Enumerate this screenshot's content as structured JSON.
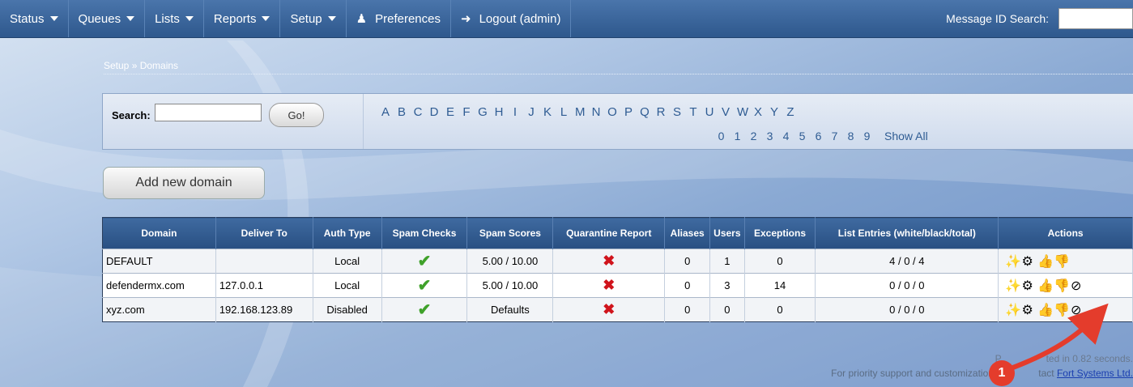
{
  "nav": {
    "items": [
      {
        "label": "Status",
        "dropdown": true
      },
      {
        "label": "Queues",
        "dropdown": true
      },
      {
        "label": "Lists",
        "dropdown": true
      },
      {
        "label": "Reports",
        "dropdown": true
      },
      {
        "label": "Setup",
        "dropdown": true
      }
    ],
    "preferences_label": "Preferences",
    "logout_label": "Logout (admin)",
    "message_search_label": "Message ID Search:"
  },
  "breadcrumb": "Setup » Domains",
  "search": {
    "label": "Search:",
    "value": "",
    "go_label": "Go!",
    "letters": [
      "A",
      "B",
      "C",
      "D",
      "E",
      "F",
      "G",
      "H",
      "I",
      "J",
      "K",
      "L",
      "M",
      "N",
      "O",
      "P",
      "Q",
      "R",
      "S",
      "T",
      "U",
      "V",
      "W",
      "X",
      "Y",
      "Z"
    ],
    "digits": [
      "0",
      "1",
      "2",
      "3",
      "4",
      "5",
      "6",
      "7",
      "8",
      "9"
    ],
    "show_all": "Show All"
  },
  "add_button_label": "Add new domain",
  "table": {
    "headers": [
      "Domain",
      "Deliver To",
      "Auth Type",
      "Spam Checks",
      "Spam Scores",
      "Quarantine Report",
      "Aliases",
      "Users",
      "Exceptions",
      "List Entries (white/black/total)",
      "Actions"
    ],
    "rows": [
      {
        "domain": "DEFAULT",
        "deliver_to": "",
        "auth_type": "Local",
        "spam_checks": "yes",
        "spam_scores": "5.00 / 10.00",
        "quarantine_report": "no",
        "aliases": "0",
        "users": "1",
        "exceptions": "0",
        "list_entries": "4 / 0 / 4",
        "actions": [
          "wand-icon",
          "gear-icon",
          "thumbs-up-icon",
          "thumbs-down-icon"
        ]
      },
      {
        "domain": "defendermx.com",
        "deliver_to": "127.0.0.1",
        "auth_type": "Local",
        "spam_checks": "yes",
        "spam_scores": "5.00 / 10.00",
        "quarantine_report": "no",
        "aliases": "0",
        "users": "3",
        "exceptions": "14",
        "list_entries": "0 / 0 / 0",
        "actions": [
          "wand-icon",
          "gear-icon",
          "thumbs-up-icon",
          "thumbs-down-icon",
          "delete-icon"
        ]
      },
      {
        "domain": "xyz.com",
        "deliver_to": "192.168.123.89",
        "auth_type": "Disabled",
        "spam_checks": "yes",
        "spam_scores": "Defaults",
        "quarantine_report": "no",
        "aliases": "0",
        "users": "0",
        "exceptions": "0",
        "list_entries": "0 / 0 / 0",
        "actions": [
          "wand-icon",
          "gear-icon",
          "thumbs-up-icon",
          "thumbs-down-icon",
          "delete-icon"
        ]
      }
    ]
  },
  "footer": {
    "line1_prefix": "P",
    "line1_suffix": "ted in 0.82 seconds.",
    "line2_prefix": "For priority support and customizations ple",
    "line2_middle": "tact ",
    "link_label": "Fort Systems Ltd."
  },
  "annotation_badge": "1",
  "colors": {
    "nav_bg": "#2e588d",
    "check": "#3fa12a",
    "cross": "#d0141c",
    "annotation": "#e43c2c"
  }
}
